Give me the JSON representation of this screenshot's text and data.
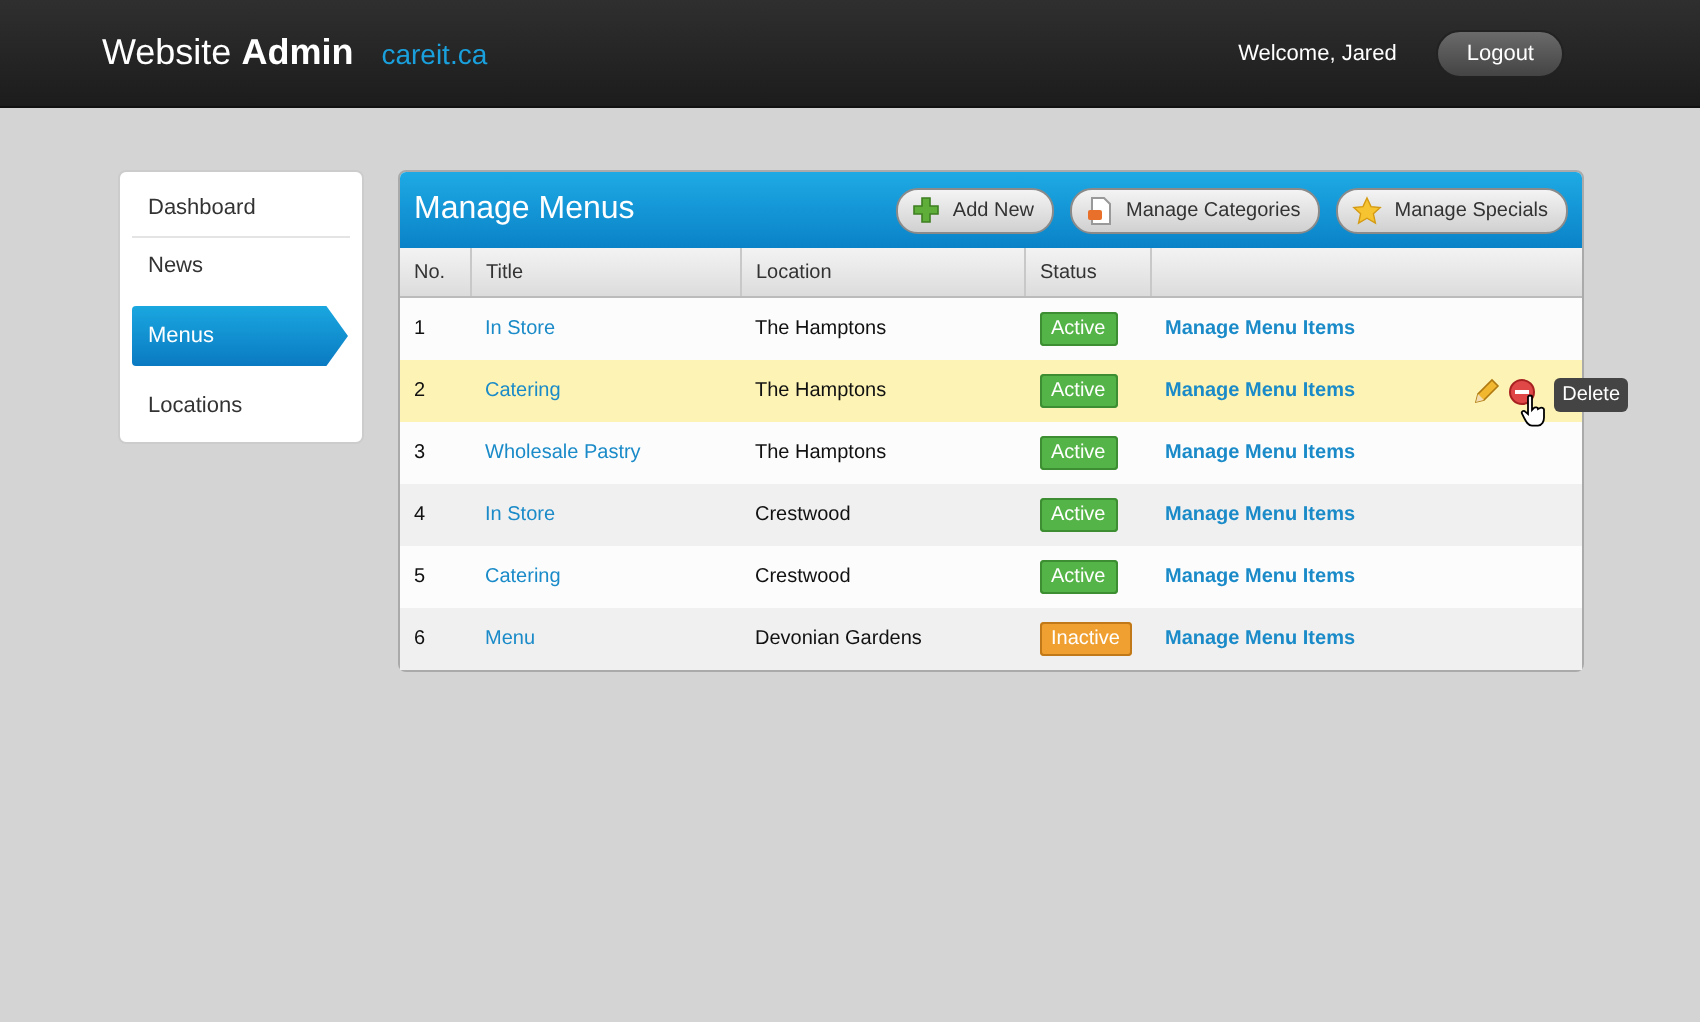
{
  "header": {
    "title_plain": "Website",
    "title_bold": "Admin",
    "site": "careit.ca",
    "welcome": "Welcome, Jared",
    "logout": "Logout"
  },
  "sidebar": {
    "items": [
      {
        "label": "Dashboard",
        "selected": false
      },
      {
        "label": "News",
        "selected": false
      },
      {
        "label": "Menus",
        "selected": true
      },
      {
        "label": "Locations",
        "selected": false
      }
    ]
  },
  "panel": {
    "title": "Manage Menus",
    "buttons": [
      {
        "label": "Add New",
        "kind": "add"
      },
      {
        "label": "Manage Categories",
        "kind": "categories"
      },
      {
        "label": "Manage Specials",
        "kind": "specials"
      }
    ],
    "columns": [
      "No.",
      "Title",
      "Location",
      "Status"
    ],
    "rows": [
      {
        "no": "1",
        "title": "In Store",
        "location": "The Hamptons",
        "status": "Active",
        "kind": "active",
        "action": "Manage Menu Items",
        "highlighted": false
      },
      {
        "no": "2",
        "title": "Catering",
        "location": "The Hamptons",
        "status": "Active",
        "kind": "active",
        "action": "Manage Menu Items",
        "highlighted": true,
        "tooltip": "Delete"
      },
      {
        "no": "3",
        "title": "Wholesale Pastry",
        "location": "The Hamptons",
        "status": "Active",
        "kind": "active",
        "action": "Manage Menu Items",
        "highlighted": false
      },
      {
        "no": "4",
        "title": "In Store",
        "location": "Crestwood",
        "status": "Active",
        "kind": "active",
        "action": "Manage Menu Items",
        "highlighted": false
      },
      {
        "no": "5",
        "title": "Catering",
        "location": "Crestwood",
        "status": "Active",
        "kind": "active",
        "action": "Manage Menu Items",
        "highlighted": false
      },
      {
        "no": "6",
        "title": "Menu",
        "location": "Devonian Gardens",
        "status": "Inactive",
        "kind": "inactive",
        "action": "Manage Menu Items",
        "highlighted": false
      }
    ]
  }
}
